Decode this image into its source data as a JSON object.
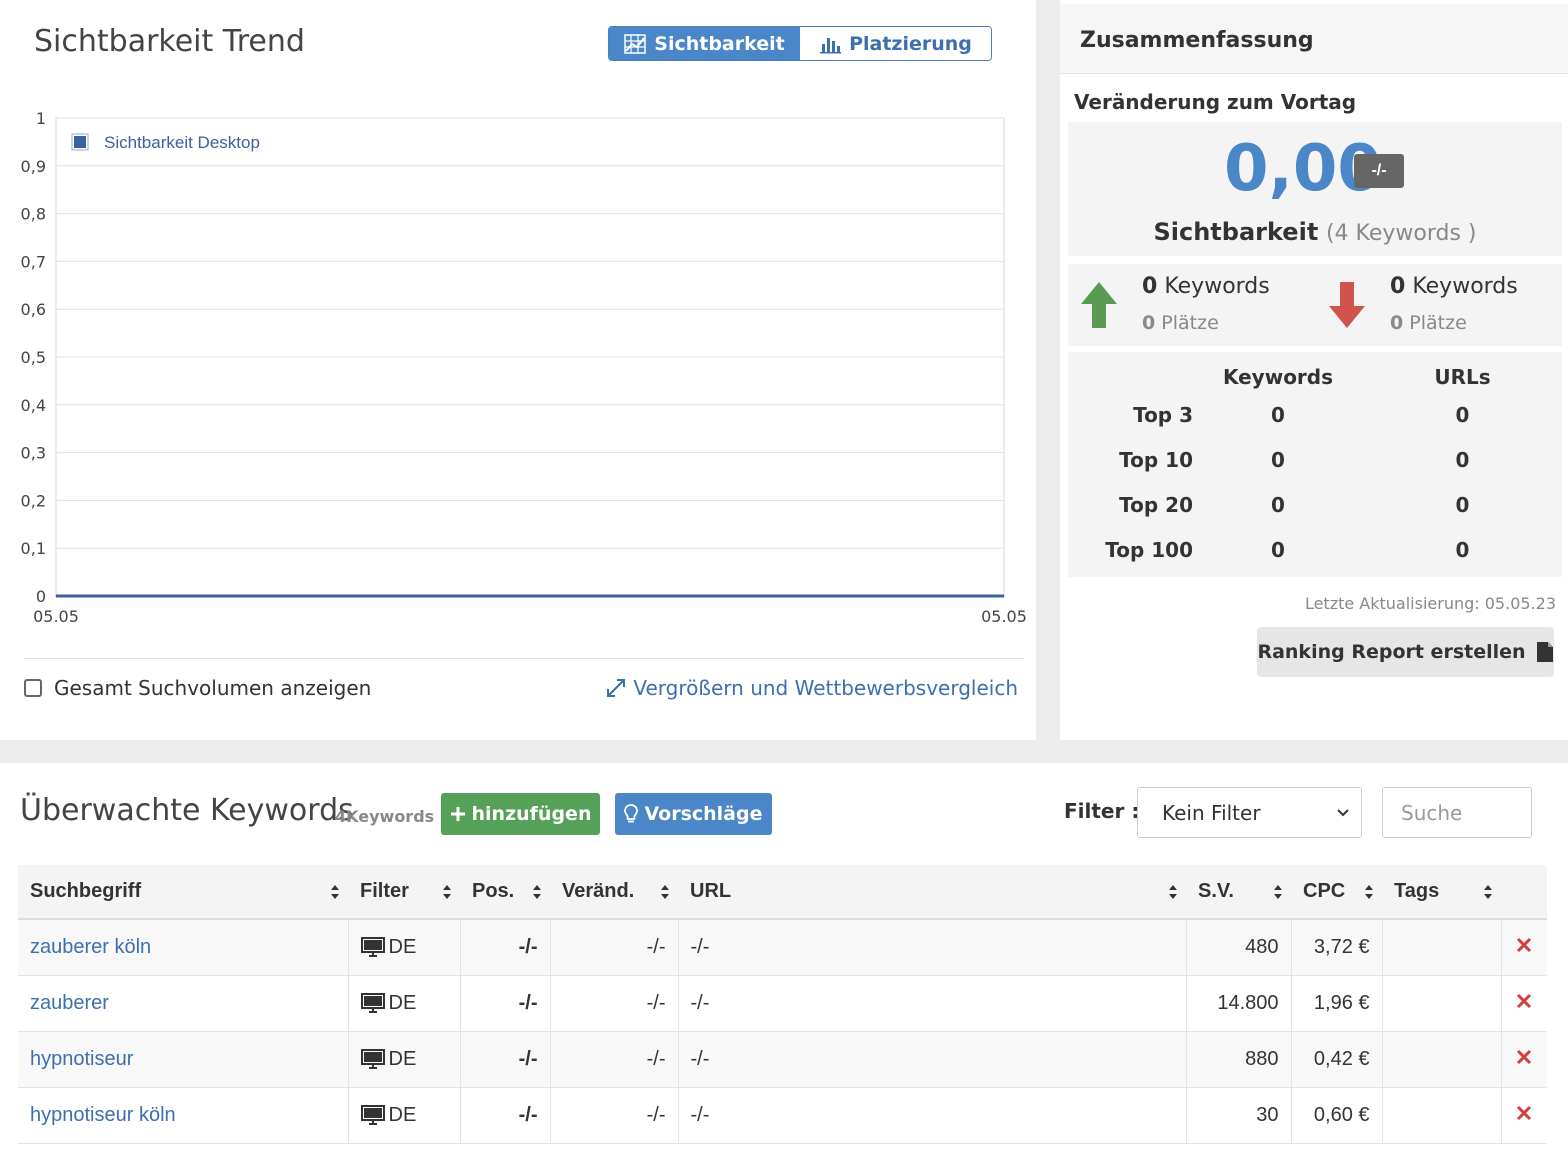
{
  "trend": {
    "title": "Sichtbarkeit Trend",
    "toggle_visibility": "Sichtbarkeit",
    "toggle_placement": "Platzierung",
    "show_volume_label": "Gesamt Suchvolumen anzeigen",
    "enlarge_link": "Vergrößern und Wettbewerbsvergleich"
  },
  "chart_data": {
    "type": "line",
    "series": [
      {
        "name": "Sichtbarkeit Desktop",
        "x": [
          "05.05",
          "05.05"
        ],
        "values": [
          0,
          0
        ],
        "color": "#3c5fa0"
      }
    ],
    "x_tick_labels": [
      "05.05",
      "05.05"
    ],
    "y_tick_labels": [
      "1",
      "0,9",
      "0,8",
      "0,7",
      "0,6",
      "0,5",
      "0,4",
      "0,3",
      "0,2",
      "0,1",
      "0"
    ],
    "ylim": [
      0,
      1
    ],
    "grid": true,
    "legend_position": "top-left"
  },
  "summary": {
    "title": "Zusammenfassung",
    "change_label": "Veränderung zum Vortag",
    "value": "0,00",
    "badge": "-/-",
    "metric_label": "Sichtbarkeit",
    "metric_sub": "(4 Keywords )",
    "up": {
      "count": "0",
      "count_label": "Keywords",
      "places": "0",
      "places_label": "Plätze",
      "color": "#5a9a55"
    },
    "down": {
      "count": "0",
      "count_label": "Keywords",
      "places": "0",
      "places_label": "Plätze",
      "color": "#d0534d"
    },
    "table": {
      "headers": [
        "Keywords",
        "URLs"
      ],
      "rows": [
        {
          "label": "Top 3",
          "keywords": "0",
          "urls": "0"
        },
        {
          "label": "Top 10",
          "keywords": "0",
          "urls": "0"
        },
        {
          "label": "Top 20",
          "keywords": "0",
          "urls": "0"
        },
        {
          "label": "Top 100",
          "keywords": "0",
          "urls": "0"
        }
      ]
    },
    "last_update": "Letzte Aktualisierung: 05.05.23",
    "report_button": "Ranking Report erstellen"
  },
  "keywords": {
    "title": "Überwachte Keywords",
    "count": "4Keywords",
    "add_button": "hinzufügen",
    "suggest_button": "Vorschläge",
    "filter_label": "Filter :",
    "filter_value": "Kein Filter",
    "search_placeholder": "Suche",
    "columns": [
      "Suchbegriff",
      "Filter",
      "Pos.",
      "Veränd.",
      "URL",
      "S.V.",
      "CPC",
      "Tags"
    ],
    "rows": [
      {
        "term": "zauberer köln",
        "filter": "DE",
        "pos": "-/-",
        "change": "-/-",
        "url": "-/-",
        "sv": "480",
        "cpc": "3,72 €",
        "tags": ""
      },
      {
        "term": "zauberer",
        "filter": "DE",
        "pos": "-/-",
        "change": "-/-",
        "url": "-/-",
        "sv": "14.800",
        "cpc": "1,96 €",
        "tags": ""
      },
      {
        "term": "hypnotiseur",
        "filter": "DE",
        "pos": "-/-",
        "change": "-/-",
        "url": "-/-",
        "sv": "880",
        "cpc": "0,42 €",
        "tags": ""
      },
      {
        "term": "hypnotiseur köln",
        "filter": "DE",
        "pos": "-/-",
        "change": "-/-",
        "url": "-/-",
        "sv": "30",
        "cpc": "0,60 €",
        "tags": ""
      }
    ]
  },
  "colors": {
    "accent": "#4a86c8",
    "success": "#55a15a",
    "danger": "#d0413b",
    "link": "#3c6fb0"
  }
}
